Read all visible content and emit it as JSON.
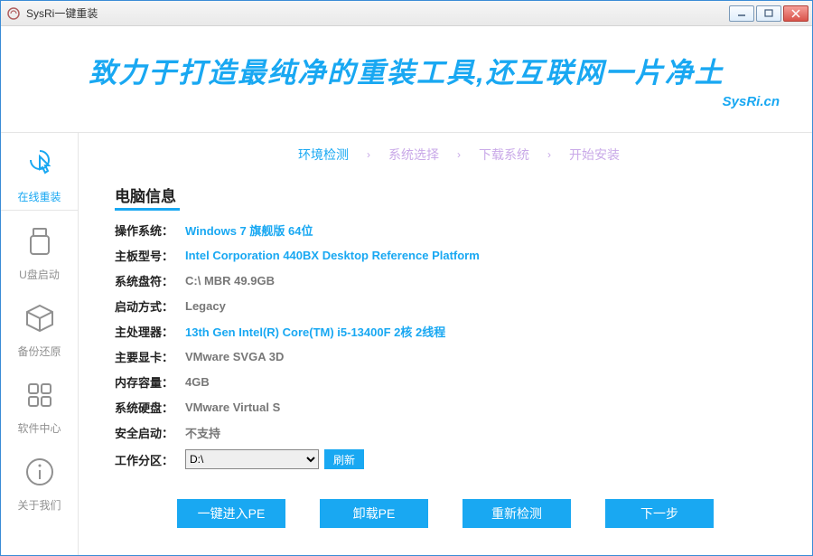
{
  "window": {
    "title": "SysRi一键重装"
  },
  "banner": {
    "slogan": "致力于打造最纯净的重装工具,还互联网一片净土",
    "site": "SysRi.cn"
  },
  "sidebar": {
    "items": [
      {
        "label": "在线重装"
      },
      {
        "label": "U盘启动"
      },
      {
        "label": "备份还原"
      },
      {
        "label": "软件中心"
      },
      {
        "label": "关于我们"
      }
    ]
  },
  "steps": {
    "items": [
      {
        "label": "环境检测"
      },
      {
        "label": "系统选择"
      },
      {
        "label": "下载系统"
      },
      {
        "label": "开始安装"
      }
    ]
  },
  "section": {
    "title": "电脑信息"
  },
  "info": {
    "os_label": "操作系统：",
    "os_value": "Windows 7 旗舰版   64位",
    "board_label": "主板型号：",
    "board_value": "Intel Corporation 440BX Desktop Reference Platform",
    "sysdrive_label": "系统盘符：",
    "sysdrive_value": "C:\\ MBR 49.9GB",
    "boot_label": "启动方式：",
    "boot_value": "Legacy",
    "cpu_label": "主处理器：",
    "cpu_value": "13th Gen Intel(R) Core(TM) i5-13400F 2核 2线程",
    "gpu_label": "主要显卡：",
    "gpu_value": "VMware SVGA 3D",
    "ram_label": "内存容量：",
    "ram_value": "4GB",
    "disk_label": "系统硬盘：",
    "disk_value": "VMware Virtual S",
    "secure_label": "安全启动：",
    "secure_value": "不支持",
    "workpart_label": "工作分区：",
    "workpart_value": "D:\\",
    "refresh": "刷新"
  },
  "footer": {
    "pe_enter": "一键进入PE",
    "pe_unload": "卸载PE",
    "recheck": "重新检测",
    "next": "下一步"
  }
}
